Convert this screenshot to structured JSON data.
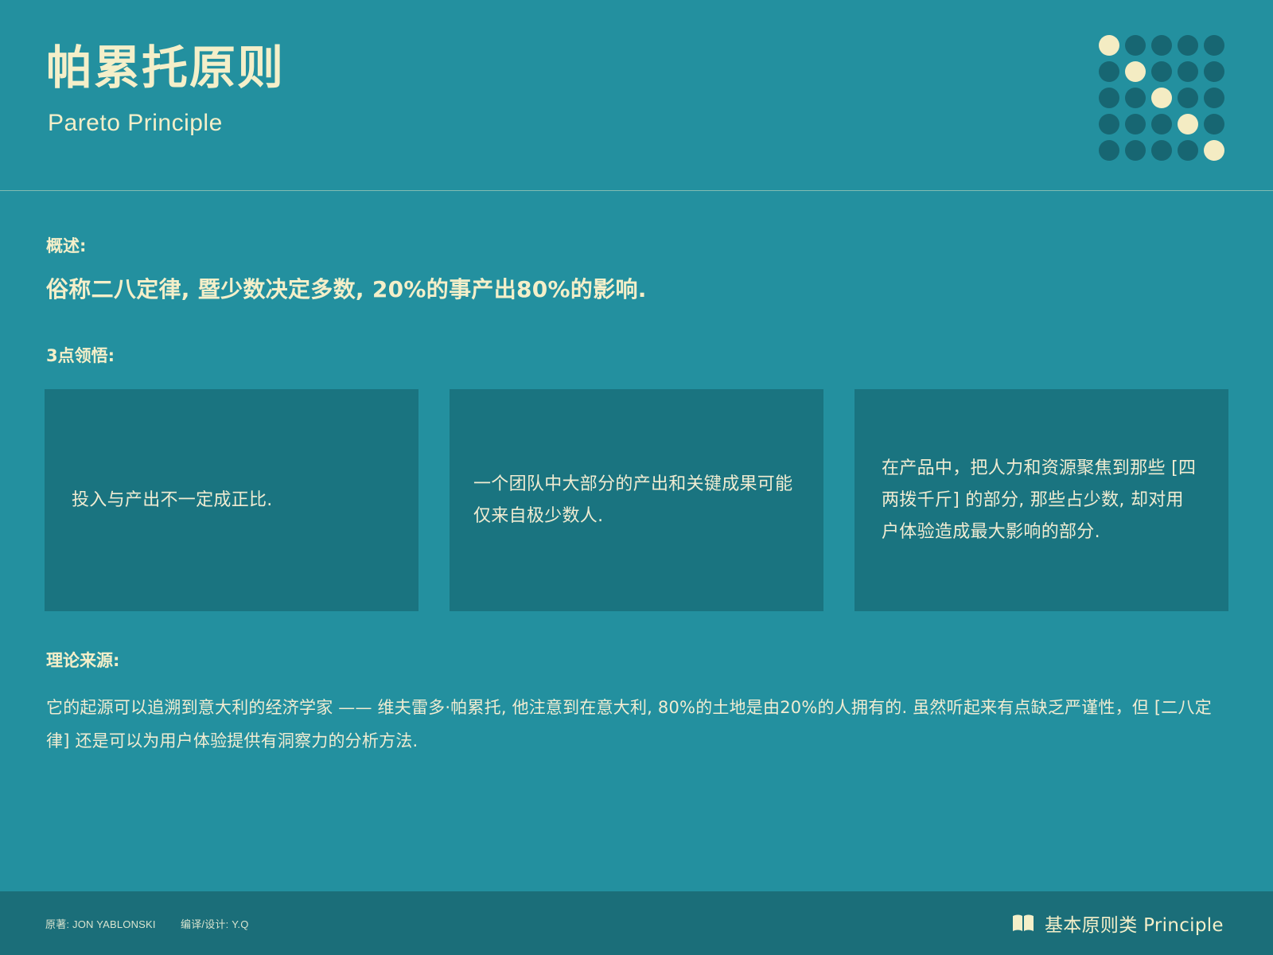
{
  "header": {
    "title": "帕累托原则",
    "subtitle": "Pareto Principle",
    "dot_grid": {
      "rows": 5,
      "cols": 5,
      "highlighted": [
        [
          0,
          0
        ],
        [
          1,
          1
        ],
        [
          2,
          2
        ],
        [
          3,
          3
        ],
        [
          4,
          4
        ]
      ],
      "dot_color": "#176672",
      "highlight_color": "#f4ecc3"
    }
  },
  "overview": {
    "label": "概述:",
    "text": "俗称二八定律, 暨少数决定多数, 20%的事产出80%的影响."
  },
  "insights": {
    "label": "3点领悟:",
    "cards": [
      {
        "text": "投入与产出不一定成正比."
      },
      {
        "text": "一个团队中大部分的产出和关键成果可能仅来自极少数人."
      },
      {
        "text": "在产品中，把人力和资源聚焦到那些 [四两拨千斤] 的部分, 那些占少数, 却对用户体验造成最大影响的部分."
      }
    ]
  },
  "source": {
    "label": "理论来源:",
    "text": "它的起源可以追溯到意大利的经济学家 —— 维夫雷多·帕累托, 他注意到在意大利, 80%的土地是由20%的人拥有的. 虽然听起来有点缺乏严谨性，但 [二八定律] 还是可以为用户体验提供有洞察力的分析方法."
  },
  "footer": {
    "author": "原著: JON YABLONSKI",
    "translator": "编译/设计: Y.Q",
    "category_icon": "book-icon",
    "category": "基本原则类 Principle"
  },
  "colors": {
    "background": "#23909f",
    "card": "#1a7480",
    "footer": "#1b6e79",
    "text": "#f4efc9"
  }
}
